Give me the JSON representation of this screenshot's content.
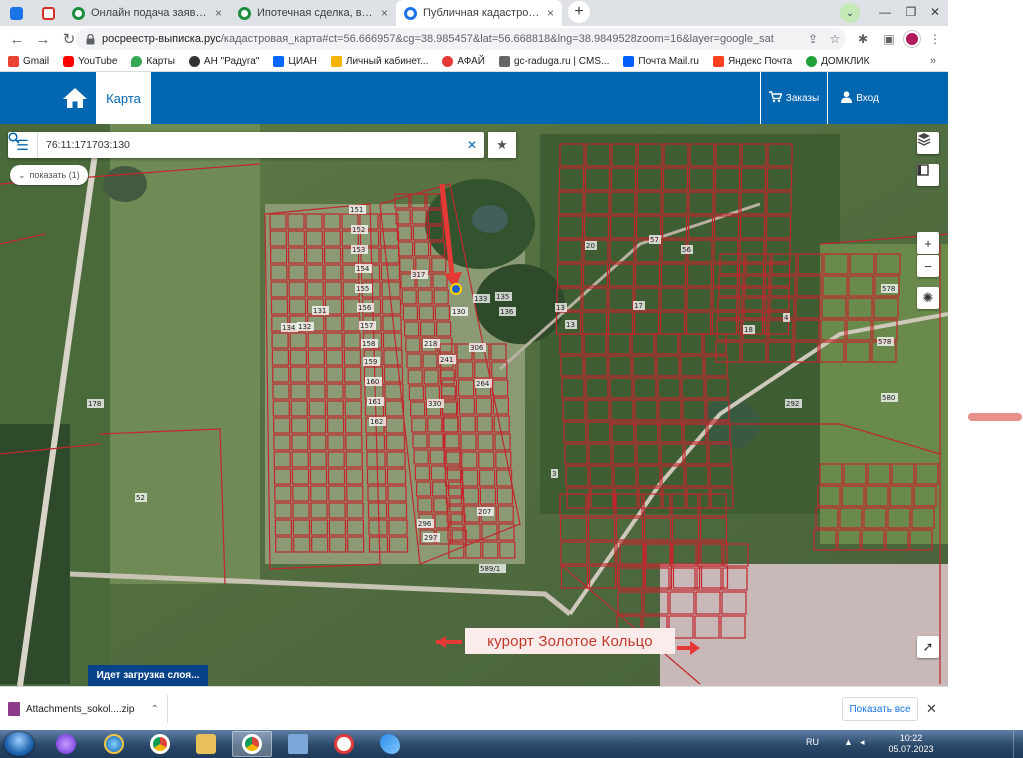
{
  "tabs": [
    {
      "label": "",
      "icon": "mail-icon"
    },
    {
      "label": "",
      "icon": "gmail-icon"
    },
    {
      "label": "Онлайн подача заявки на ипотe",
      "icon": "green-circle-icon"
    },
    {
      "label": "Ипотечная сделка, войти в личн",
      "icon": "green-circle-icon"
    },
    {
      "label": "Публичная кадастровая карта Р",
      "icon": "blue-circle-icon",
      "active": true
    }
  ],
  "address": {
    "host": "росреестр-выписка.рус",
    "path": "/кадастровая_карта#ct=56.666957&cg=38.985457&lat=56.668818&lng=38.9849528zoom=16&layer=google_sat"
  },
  "bookmarks": [
    "Gmail",
    "YouTube",
    "Карты",
    "АН \"Радуга\"",
    "ЦИАН",
    "Личный кабинет...",
    "АФАЙ",
    "gc-raduga.ru | CMS...",
    "Почта Mail.ru",
    "Яндекс Почта",
    "ДОМКЛИК"
  ],
  "site": {
    "map_tab": "Карта",
    "orders": "Заказы",
    "login": "Вход"
  },
  "map": {
    "search_value": "76:11:171703:130",
    "show_pill": "показать (1)",
    "loading": "Идет загрузка слоя...",
    "caption": "курорт Золотое Кольцо",
    "zoom_in": "+",
    "zoom_out": "−"
  },
  "parcel_labels": [
    {
      "t": "151"
    },
    {
      "t": "152"
    },
    {
      "t": "153"
    },
    {
      "t": "154"
    },
    {
      "t": "155"
    },
    {
      "t": "156"
    },
    {
      "t": "157"
    },
    {
      "t": "158"
    },
    {
      "t": "159"
    },
    {
      "t": "160"
    },
    {
      "t": "161"
    },
    {
      "t": "162"
    },
    {
      "t": "317"
    },
    {
      "t": "130"
    },
    {
      "t": "133"
    },
    {
      "t": "135"
    },
    {
      "t": "136"
    },
    {
      "t": "306"
    },
    {
      "t": "218"
    },
    {
      "t": "241"
    },
    {
      "t": "264"
    },
    {
      "t": "330"
    },
    {
      "t": "207"
    },
    {
      "t": "296"
    },
    {
      "t": "297"
    },
    {
      "t": "134"
    },
    {
      "t": "132"
    },
    {
      "t": "131"
    },
    {
      "t": "178"
    },
    {
      "t": "52"
    },
    {
      "t": "589/1"
    },
    {
      "t": "580"
    },
    {
      "t": "578"
    },
    {
      "t": "578"
    },
    {
      "t": "292"
    },
    {
      "t": "13"
    },
    {
      "t": "13"
    },
    {
      "t": "17"
    },
    {
      "t": "20"
    },
    {
      "t": "3"
    },
    {
      "t": "18"
    },
    {
      "t": "4"
    },
    {
      "t": "57"
    },
    {
      "t": "56"
    }
  ],
  "download": {
    "filename": "Attachments_sokol....zip",
    "show_all": "Показать все"
  },
  "taskbar": {
    "lang": "RU",
    "time": "10:22",
    "date": "05.07.2023"
  }
}
